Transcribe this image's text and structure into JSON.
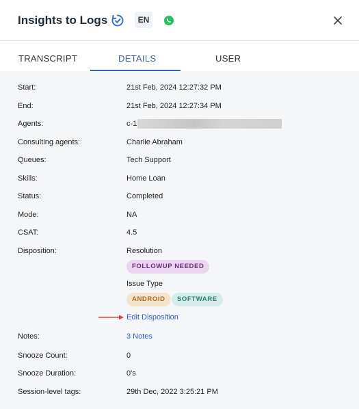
{
  "header": {
    "title": "Insights to Logs",
    "language_badge": "EN",
    "icons": [
      "refresh-check-icon",
      "whatsapp-icon",
      "close-icon"
    ]
  },
  "tabs": [
    {
      "label": "TRANSCRIPT",
      "active": false
    },
    {
      "label": "DETAILS",
      "active": true
    },
    {
      "label": "USER",
      "active": false
    }
  ],
  "details": {
    "start": {
      "label": "Start:",
      "value": "21st Feb, 2024 12:27:32 PM"
    },
    "end": {
      "label": "End:",
      "value": "21st Feb, 2024 12:27:34 PM"
    },
    "agents": {
      "label": "Agents:",
      "value": "c-1"
    },
    "consulting_agents": {
      "label": "Consulting agents:",
      "value": "Charlie Abraham"
    },
    "queues": {
      "label": "Queues:",
      "value": "Tech Support"
    },
    "skills": {
      "label": "Skills:",
      "value": "Home Loan"
    },
    "status": {
      "label": "Status:",
      "value": "Completed"
    },
    "mode": {
      "label": "Mode:",
      "value": "NA"
    },
    "csat": {
      "label": "CSAT:",
      "value": "4.5"
    },
    "disposition": {
      "label": "Disposition:",
      "resolution_heading": "Resolution",
      "resolution_tags": [
        "FOLLOWUP NEEDED"
      ],
      "issue_type_heading": "Issue Type",
      "issue_type_tags": [
        "ANDROID",
        "SOFTWARE"
      ],
      "edit_link": "Edit Disposition"
    },
    "notes": {
      "label": "Notes:",
      "value": "3 Notes"
    },
    "snooze_count": {
      "label": "Snooze Count:",
      "value": "0"
    },
    "snooze_duration": {
      "label": "Snooze Duration:",
      "value": "0's"
    },
    "session_tags": {
      "label": "Session-level tags:",
      "value": "29th Dec, 2022 3:25:21 PM"
    }
  },
  "colors": {
    "accent": "#3a62a8",
    "link": "#2f5bd4",
    "arrow": "#e0463a",
    "chip_purple": "#ead6f0",
    "chip_orange": "#f4e3cd",
    "chip_teal": "#d5ecea"
  }
}
